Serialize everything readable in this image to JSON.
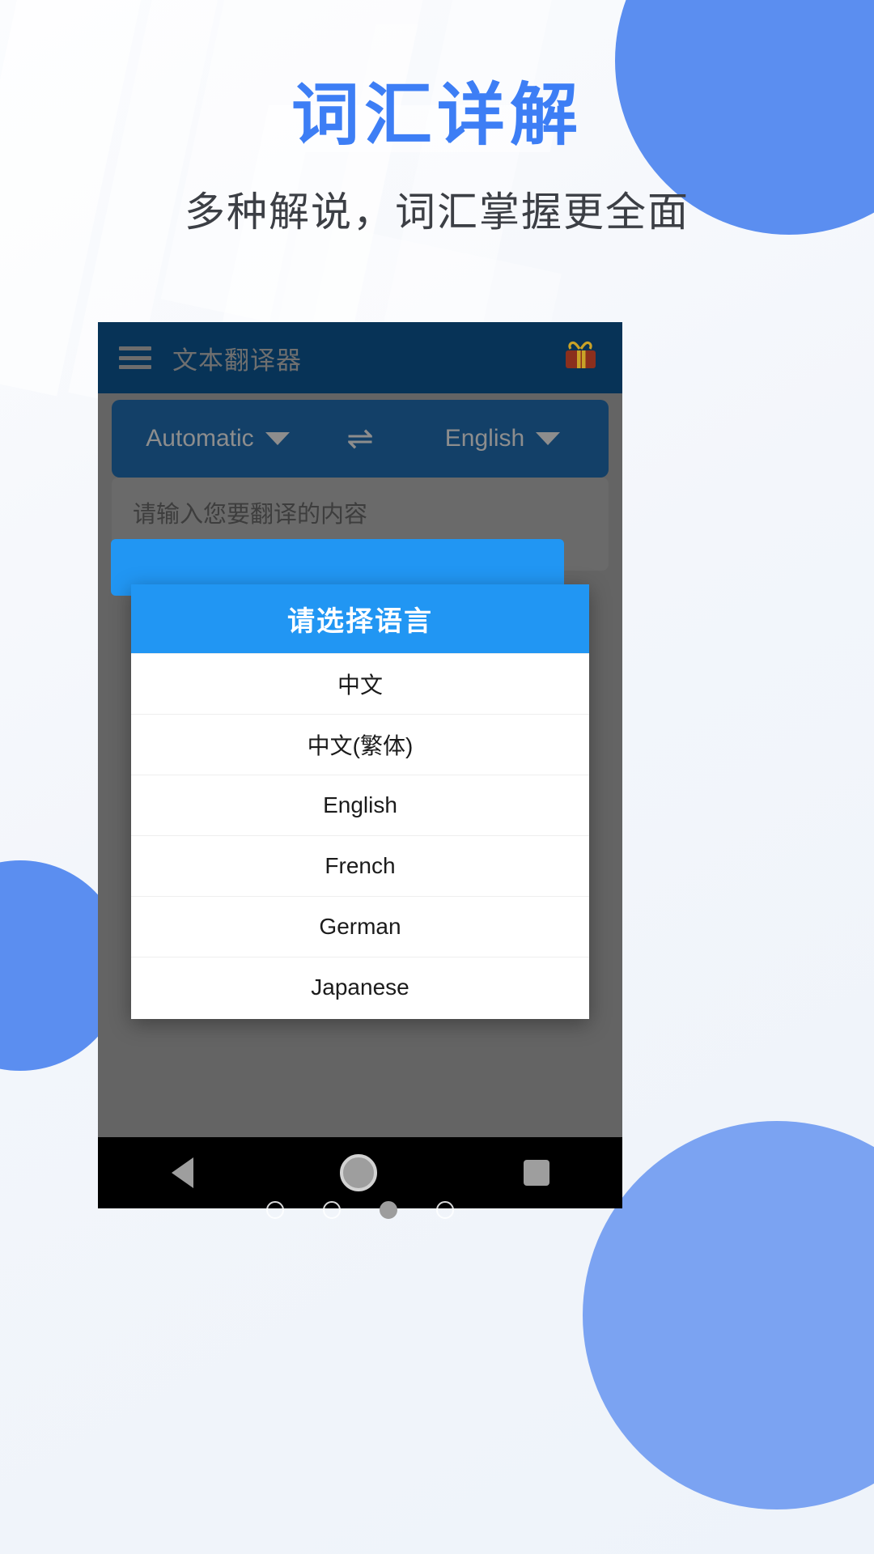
{
  "hero": {
    "title": "词汇详解",
    "subtitle": "多种解说，词汇掌握更全面",
    "title_color": "#3d7ef5",
    "subtitle_color": "#3c3f45"
  },
  "appbar": {
    "title": "文本翻译器",
    "menu_icon": "hamburger-icon",
    "action_icon": "gift-icon",
    "background_color": "#073357"
  },
  "language_bar": {
    "source_label": "Automatic",
    "target_label": "English",
    "swap_icon": "swap-horizontal-icon",
    "background_color": "#134068"
  },
  "input": {
    "placeholder": "请输入您要翻译的内容",
    "button_color": "#2196f3"
  },
  "dialog": {
    "title": "请选择语言",
    "header_color": "#2196f3",
    "items": [
      {
        "label": "中文"
      },
      {
        "label": "中文(繁体)"
      },
      {
        "label": "English"
      },
      {
        "label": "French"
      },
      {
        "label": "German"
      },
      {
        "label": "Japanese"
      }
    ]
  },
  "navbar": {
    "back_icon": "back-triangle-icon",
    "home_icon": "home-circle-icon",
    "recents_icon": "recents-square-icon"
  },
  "pager": {
    "total": 4,
    "active_index": 3
  },
  "decor": {
    "blob_color": "#5b8ef0",
    "blob_color_light": "#7ba3f2"
  }
}
